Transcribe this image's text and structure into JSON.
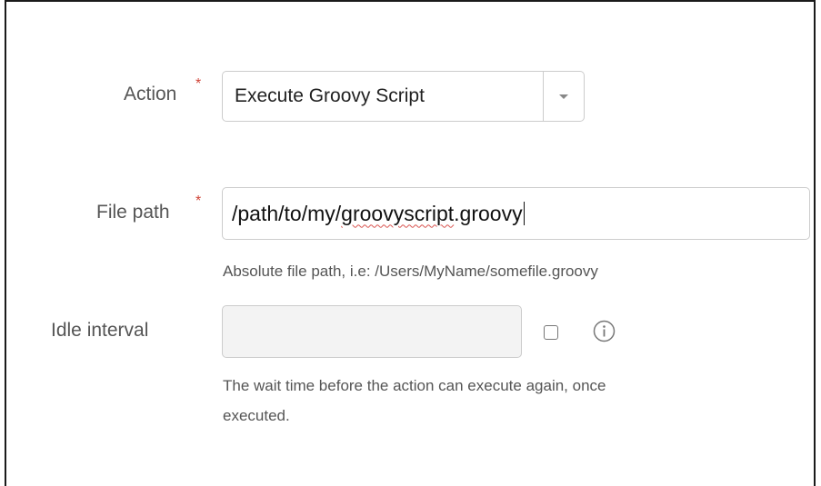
{
  "action": {
    "label": "Action",
    "required_marker": "*",
    "selected_value": "Execute Groovy Script",
    "toggle_icon": "chevron-down-icon"
  },
  "file_path": {
    "label": "File path",
    "required_marker": "*",
    "value_prefix": "/path/to/my/",
    "value_flagged": "groovyscript",
    "value_suffix": ".groovy",
    "help_text": "Absolute file path, i.e: /Users/MyName/somefile.groovy"
  },
  "idle_interval": {
    "label": "Idle interval",
    "value": "",
    "checkbox_checked": false,
    "info_icon": "info-icon",
    "help_text_line1": "The wait time before the action can execute again, once",
    "help_text_line2": "executed."
  },
  "colors": {
    "required": "#d04437",
    "label": "#555555",
    "border": "#cccccc",
    "disabled_bg": "#f3f3f3"
  }
}
